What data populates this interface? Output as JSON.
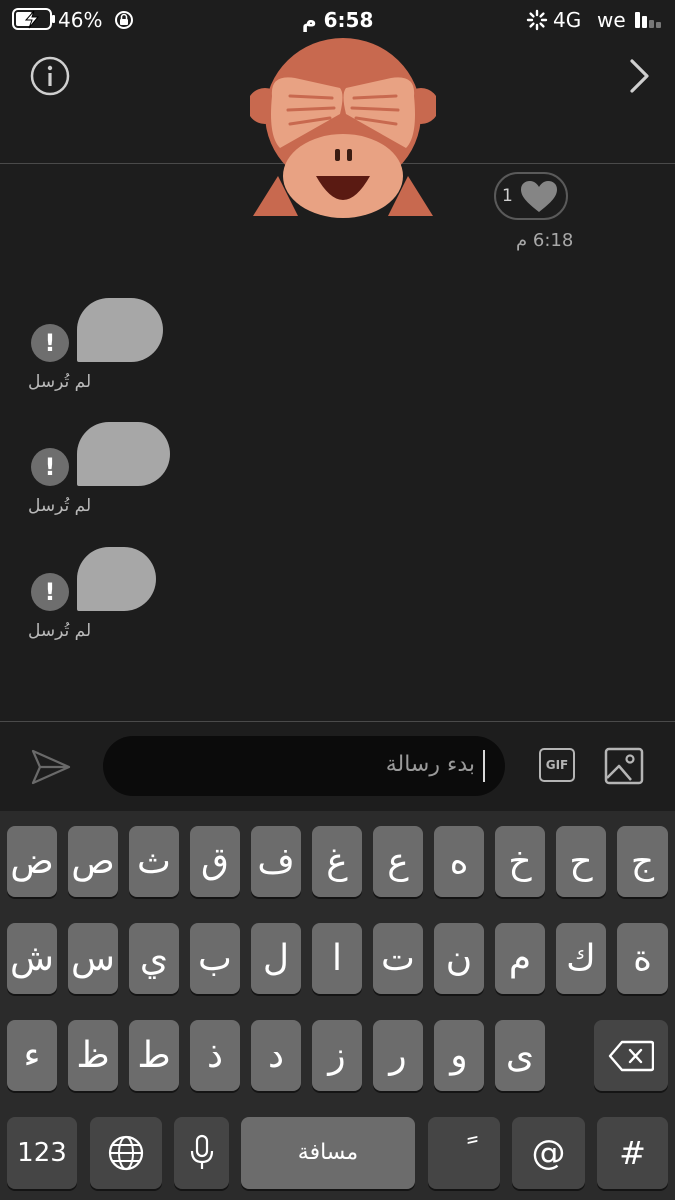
{
  "status_bar": {
    "battery": "46%",
    "time": "6:58 م",
    "network": "4G",
    "carrier": "we"
  },
  "header": {
    "info_icon": "info-icon",
    "forward_icon": "chevron-right-icon",
    "sticker": "see-no-evil-monkey-sticker"
  },
  "reaction": {
    "count": "1",
    "icon": "heart-icon"
  },
  "message_time": "6:18 م",
  "unsent_messages": [
    {
      "status": "لم تُرسل"
    },
    {
      "status": "لم تُرسل"
    },
    {
      "status": "لم تُرسل"
    }
  ],
  "composer": {
    "placeholder": "بدء رسالة",
    "gif_label": "GIF"
  },
  "keyboard": {
    "row1": [
      "ج",
      "ح",
      "خ",
      "ه",
      "ع",
      "غ",
      "ف",
      "ق",
      "ث",
      "ص",
      "ض"
    ],
    "row2": [
      "ة",
      "ك",
      "م",
      "ن",
      "ت",
      "ا",
      "ل",
      "ب",
      "ي",
      "س",
      "ش"
    ],
    "row3": [
      "ى",
      "و",
      "ر",
      "ز",
      "د",
      "ذ",
      "ط",
      "ظ",
      "ء"
    ],
    "numbers": "123",
    "space": "مسافة",
    "diacritic": "ً",
    "at": "@",
    "hash": "#"
  },
  "colors": {
    "background": "#1d1d1d",
    "bubble": "#a7a7a7",
    "monkey": "#c8694f",
    "keyboard": "#2b2b2b",
    "key": "#6c6c6c"
  }
}
